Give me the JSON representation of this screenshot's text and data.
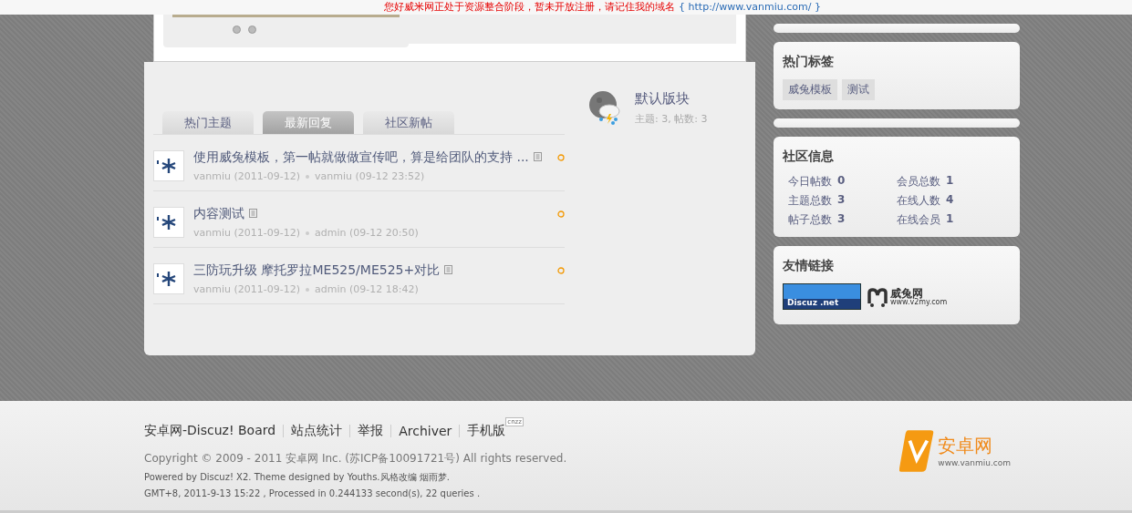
{
  "notice": {
    "text": "您好威米网正处于资源整合阶段，暂未开放注册，请记住我的域名",
    "link": "{ http://www.vanmiu.com/ }"
  },
  "slideshow": {
    "dots": [
      {
        "selected": false
      },
      {
        "selected": false
      }
    ]
  },
  "tabs": [
    {
      "label": "热门主题",
      "selected": false
    },
    {
      "label": "最新回复",
      "selected": true
    },
    {
      "label": "社区新帖",
      "selected": false
    }
  ],
  "threads": [
    {
      "title": "使用威兔模板，第一帖就做做宣传吧，算是给团队的支持 ...",
      "author": "vanmiu (2011-09-12)",
      "last": "vanmiu (09-12 23:52)"
    },
    {
      "title": "内容测试",
      "author": "vanmiu (2011-09-12)",
      "last": "admin (09-12 20:50)"
    },
    {
      "title": "三防玩升级 摩托罗拉ME525/ME525+对比",
      "author": "vanmiu (2011-09-12)",
      "last": "admin (09-12 18:42)"
    }
  ],
  "forum": {
    "name": "默认版块",
    "stats": "主题: 3, 帖数: 3"
  },
  "hot_tags": {
    "title": "热门标签",
    "tags": [
      "威兔模板",
      "测试"
    ]
  },
  "community_info": {
    "title": "社区信息",
    "stats": [
      {
        "label": "今日帖数",
        "value": "0"
      },
      {
        "label": "会员总数",
        "value": "1"
      },
      {
        "label": "主题总数",
        "value": "3"
      },
      {
        "label": "在线人数",
        "value": "4"
      },
      {
        "label": "帖子总数",
        "value": "3"
      },
      {
        "label": "在线会员",
        "value": "1"
      }
    ]
  },
  "friend_links": {
    "title": "友情链接",
    "logos": [
      {
        "kind": "discuz",
        "text": "Discuz .net"
      },
      {
        "kind": "v2my",
        "text": "威兔网",
        "sub": "www.v2my.com"
      }
    ]
  },
  "footer": {
    "links": [
      "安卓网-Discuz! Board",
      "站点统计",
      "举报",
      "Archiver",
      "手机版"
    ],
    "stats_badge": "cnzz",
    "copyright": "Copyright © 2009 - 2011 安卓网 Inc. (苏ICP备10091721号) All rights reserved.",
    "powered": "Powered by Discuz! X2. Theme designed by Youths.风格改编 烟雨梦.",
    "timing": "GMT+8, 2011-9-13 15:22 , Processed in 0.244133 second(s), 22 queries .",
    "logo": {
      "name": "安卓网",
      "url": "www.vanmiu.com"
    }
  }
}
